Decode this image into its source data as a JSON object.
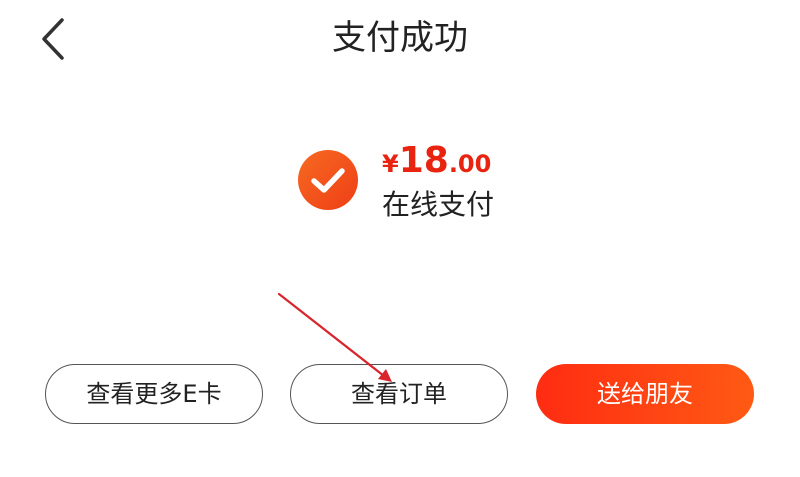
{
  "header": {
    "title": "支付成功",
    "back_icon": "chevron-left-icon"
  },
  "payment": {
    "status_icon": "check-circle-icon",
    "status_color": "#f05a1c",
    "currency": "¥",
    "amount_integer": "18",
    "amount_decimal": ".00",
    "amount_color": "#e8230f",
    "method": "在线支付"
  },
  "actions": {
    "view_more_ecards": "查看更多E卡",
    "view_order": "查看订单",
    "send_to_friend": "送给朋友"
  },
  "colors": {
    "primary_gradient_start": "#ff2c12",
    "primary_gradient_end": "#ff5a14",
    "annotation_arrow": "#d9242b"
  }
}
